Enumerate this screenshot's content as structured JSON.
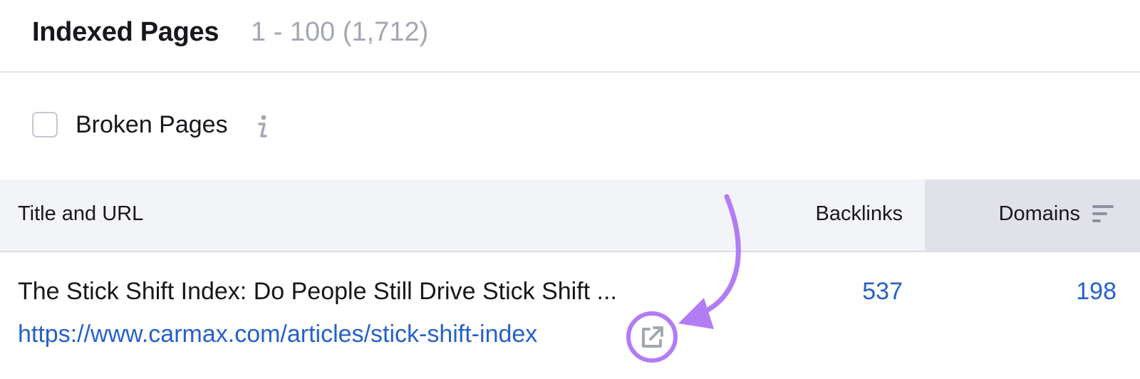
{
  "header": {
    "title": "Indexed Pages",
    "range": "1 - 100 (1,712)"
  },
  "filters": {
    "broken_pages_label": "Broken Pages",
    "broken_pages_checked": false,
    "info_icon": "info-icon"
  },
  "table": {
    "columns": {
      "title_url": "Title and URL",
      "backlinks": "Backlinks",
      "domains": "Domains"
    },
    "sorted_column": "domains",
    "rows": [
      {
        "title": "The Stick Shift Index: Do People Still Drive Stick Shift ...",
        "url": "https://www.carmax.com/articles/stick-shift-index",
        "backlinks": "537",
        "domains": "198"
      }
    ]
  },
  "colors": {
    "accent_link": "#2561c9",
    "annotation": "#b27cf5",
    "muted": "#a3a7b3"
  },
  "annotation": {
    "type": "arrow-and-circle",
    "target": "external-link-icon"
  }
}
